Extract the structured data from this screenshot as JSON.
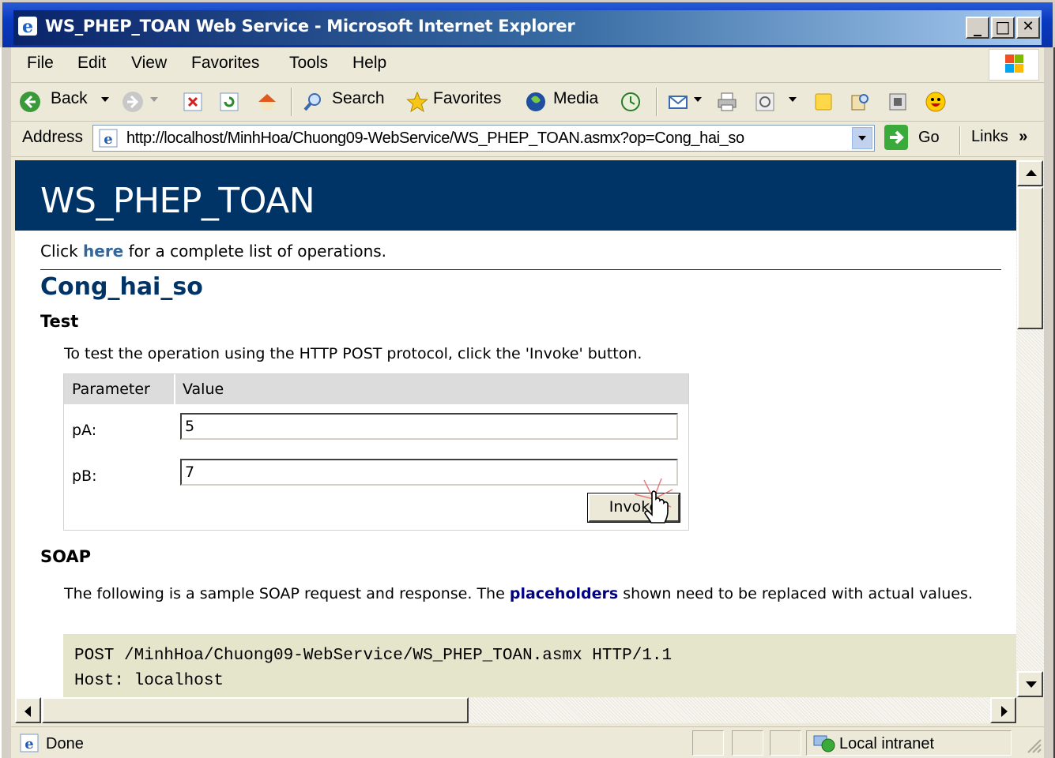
{
  "window": {
    "title": "WS_PHEP_TOAN Web Service - Microsoft Internet Explorer",
    "minimize": "_",
    "maximize": "□",
    "close": "✕"
  },
  "menu": {
    "items": [
      "File",
      "Edit",
      "View",
      "Favorites",
      "Tools",
      "Help"
    ]
  },
  "toolbar": {
    "back_label": "Back",
    "search_label": "Search",
    "favorites_label": "Favorites",
    "media_label": "Media"
  },
  "address": {
    "label": "Address",
    "url": "http://localhost/MinhHoa/Chuong09-WebService/WS_PHEP_TOAN.asmx?op=Cong_hai_so",
    "go_label": "Go",
    "links_label": "Links",
    "links_chevron": "»"
  },
  "page": {
    "title": "WS_PHEP_TOAN",
    "intro_before": "Click ",
    "intro_link": "here",
    "intro_after": " for a complete list of operations.",
    "operation": "Cong_hai_so",
    "test_heading": "Test",
    "test_description": "To test the operation using the HTTP POST protocol, click the 'Invoke' button.",
    "form": {
      "col_parameter": "Parameter",
      "col_value": "Value",
      "params": [
        {
          "name": "pA:",
          "value": "5"
        },
        {
          "name": "pB:",
          "value": "7"
        }
      ],
      "invoke_label": "Invoke"
    },
    "soap_heading": "SOAP",
    "soap_desc_before": "The following is a sample SOAP request and response. The ",
    "soap_desc_link": "placeholders",
    "soap_desc_after": " shown need to be replaced with actual values.",
    "code_lines": [
      "POST /MinhHoa/Chuong09-WebService/WS_PHEP_TOAN.asmx HTTP/1.1",
      "Host: localhost"
    ]
  },
  "status": {
    "text": "Done",
    "zone": "Local intranet"
  },
  "colors": {
    "header_band": "#003366",
    "link": "#336699",
    "placeholder_link": "#000080",
    "code_background": "#e5e5cc"
  }
}
